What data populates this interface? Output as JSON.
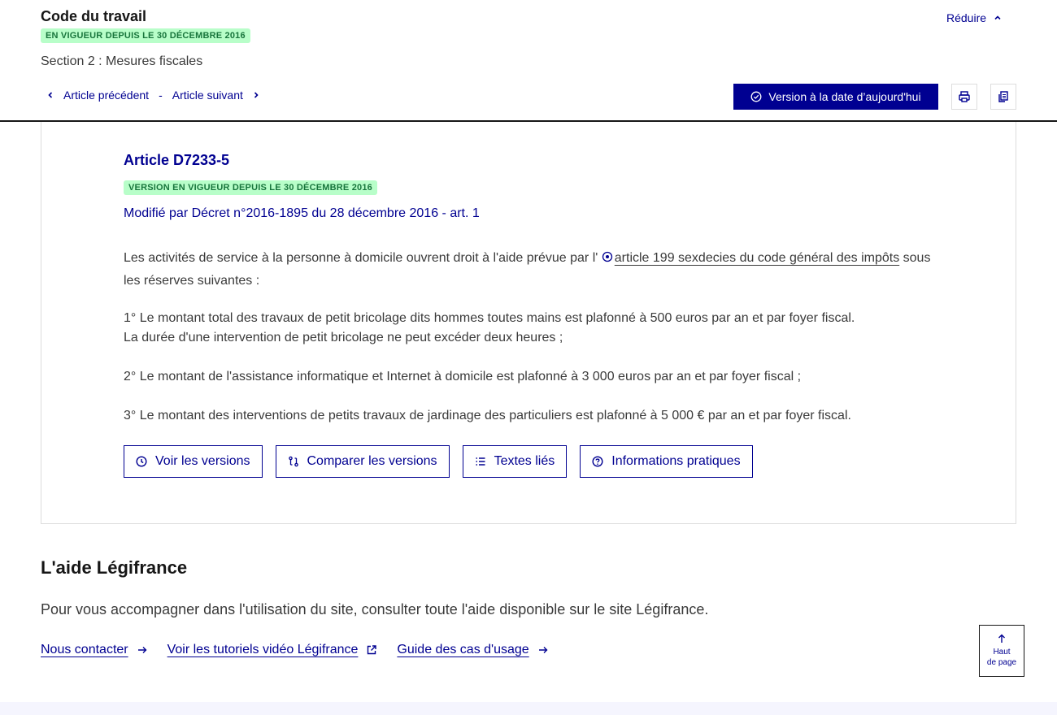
{
  "header": {
    "code_title": "Code du travail",
    "badge": "EN VIGUEUR DEPUIS LE 30 DÉCEMBRE 2016",
    "reduire": "Réduire",
    "section_title": "Section 2 : Mesures fiscales",
    "prev_article": "Article précédent",
    "separator": "-",
    "next_article": "Article suivant",
    "version_button": "Version à la date d’aujourd'hui",
    "print_icon": "printer-icon",
    "copy_icon": "copy-icon"
  },
  "article": {
    "title": "Article D7233-5",
    "badge": "VERSION EN VIGUEUR DEPUIS LE 30 DÉCEMBRE 2016",
    "modified_by": "Modifié par Décret n°2016-1895 du 28 décembre 2016 - art. 1",
    "p1_before": "Les activités de service à la personne à domicile ouvrent droit à l'aide prévue par l' ",
    "p1_link": "article 199 sexdecies du code général des impôts",
    "p1_after": " sous les réserves suivantes :",
    "p2_line1": "1° Le montant total des travaux de petit bricolage dits hommes toutes mains est plafonné à 500 euros par an et par foyer fiscal.",
    "p2_line2": "La durée d'une intervention de petit bricolage ne peut excéder deux heures ;",
    "p3": "2° Le montant de l'assistance informatique et Internet à domicile est plafonné à 3 000 euros par an et par foyer fiscal ;",
    "p4": "3° Le montant des interventions de petits travaux de jardinage des particuliers est plafonné à 5 000 € par an et par foyer fiscal.",
    "actions": {
      "versions": "Voir les versions",
      "compare": "Comparer les versions",
      "linked": "Textes liés",
      "info": "Informations pratiques"
    }
  },
  "help": {
    "title": "L'aide Légifrance",
    "text": "Pour vous accompagner dans l'utilisation du site, consulter toute l'aide disponible sur le site Légifrance.",
    "contact": "Nous contacter",
    "tutorials": "Voir les tutoriels vidéo Légifrance",
    "guide": "Guide des cas d'usage"
  },
  "back_to_top": {
    "line1": "Haut",
    "line2": "de page"
  },
  "colors": {
    "primary": "#000091",
    "badge_bg": "#b8fec9",
    "badge_text": "#18753c"
  }
}
